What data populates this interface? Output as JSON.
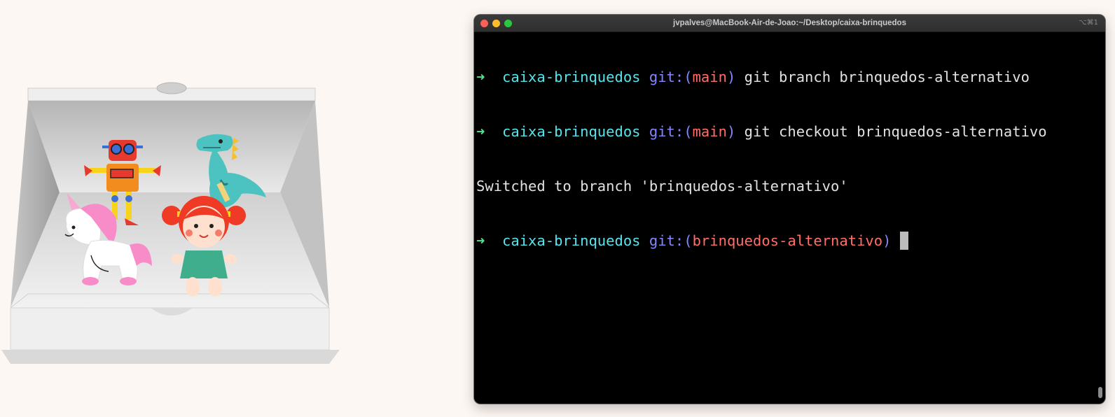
{
  "window": {
    "title": "jvpalves@MacBook-Air-de-Joao:~/Desktop/caixa-brinquedos",
    "shortcut": "⌥⌘1"
  },
  "terminal": {
    "lines": [
      {
        "arrow": "➜",
        "dir": "caixa-brinquedos",
        "git_open": "git:(",
        "branch": "main",
        "git_close": ")",
        "command": "git branch brinquedos-alternativo"
      },
      {
        "arrow": "➜",
        "dir": "caixa-brinquedos",
        "git_open": "git:(",
        "branch": "main",
        "git_close": ")",
        "command": "git checkout brinquedos-alternativo"
      },
      {
        "output": "Switched to branch 'brinquedos-alternativo'"
      },
      {
        "arrow": "➜",
        "dir": "caixa-brinquedos",
        "git_open": "git:(",
        "branch": "brinquedos-alternativo",
        "git_close": ")",
        "command": ""
      }
    ]
  },
  "colors": {
    "background": "#fdf7f3",
    "prompt_arrow": "#4fe394",
    "directory": "#56e4ec",
    "git_label": "#8486ff",
    "branch": "#ff6e67"
  },
  "illustration": {
    "toys": [
      "robot-icon",
      "dinosaur-icon",
      "unicorn-icon",
      "doll-icon"
    ],
    "container": "open-box-icon"
  }
}
